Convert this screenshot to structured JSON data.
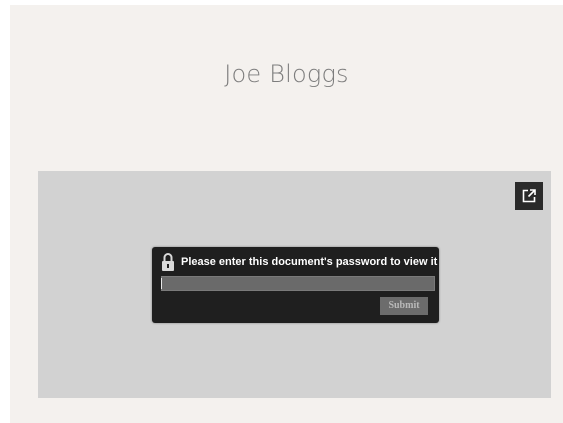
{
  "header": {
    "title": "Joe Bloggs"
  },
  "viewer": {
    "popout_icon": "open-in-new-icon",
    "password_dialog": {
      "lock_icon": "padlock-icon",
      "prompt": "Please enter this document's password to view it",
      "password_value": "",
      "submit_label": "Submit"
    }
  },
  "colors": {
    "page_background": "#f4f1ee",
    "viewer_background": "#d2d2d2",
    "dialog_background": "#1f1f1f",
    "title_text": "#7d7d7d"
  }
}
